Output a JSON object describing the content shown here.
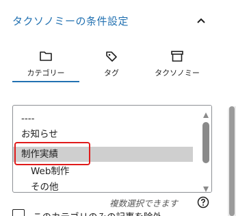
{
  "panel": {
    "title": "タクソノミーの条件設定"
  },
  "tabs": [
    {
      "label": "カテゴリー",
      "icon": "folder-icon",
      "active": true
    },
    {
      "label": "タグ",
      "icon": "tag-icon",
      "active": false
    },
    {
      "label": "タクソノミー",
      "icon": "archive-icon",
      "active": false
    }
  ],
  "listbox": {
    "options": [
      {
        "label": "----",
        "level": 0,
        "selected": false
      },
      {
        "label": "お知らせ",
        "level": 0,
        "selected": false
      },
      {
        "label": "制作実績",
        "level": 0,
        "selected": true
      },
      {
        "label": "Web制作",
        "level": 1,
        "selected": false
      },
      {
        "label": "その他",
        "level": 1,
        "selected": false
      }
    ]
  },
  "hint": {
    "text": "複数選択できます"
  },
  "exclude": {
    "label": "このカテゴリのみの記事を除外"
  },
  "colors": {
    "accent": "#2271b1",
    "highlight": "#e01b1b",
    "selected_bg": "#cfcfcf"
  }
}
